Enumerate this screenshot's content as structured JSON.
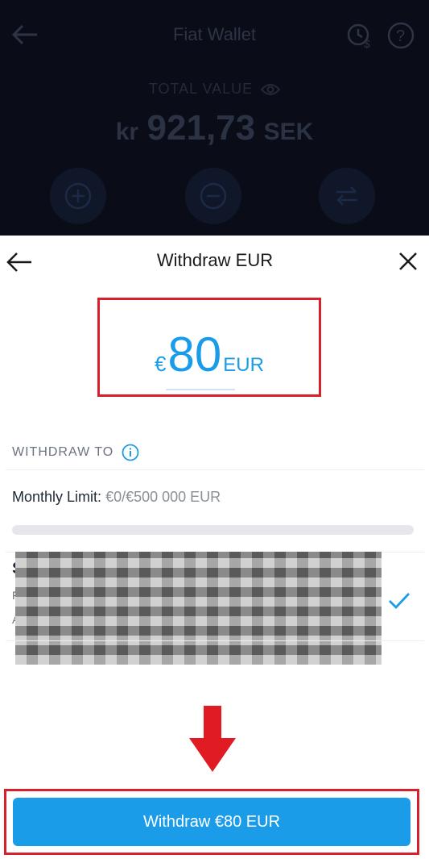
{
  "background_screen": {
    "title": "Fiat Wallet",
    "total_label": "TOTAL VALUE",
    "total_currency_prefix": "kr",
    "total_amount": "921,73",
    "total_currency_code": "SEK",
    "icons": {
      "back": "back-arrow-icon",
      "history": "clock-dollar-icon",
      "help": "question-icon",
      "visibility": "eye-icon",
      "add": "plus-circle-icon",
      "remove": "minus-circle-icon",
      "transfer": "transfer-arrows-icon"
    }
  },
  "sheet": {
    "title": "Withdraw EUR",
    "amount_symbol": "€",
    "amount_value": "80",
    "amount_code": "EUR",
    "withdraw_to_label": "WITHDRAW TO",
    "monthly_limit_label": "Monthly Limit:",
    "monthly_limit_value": "€0/€500 000 EUR",
    "monthly_limit_used_fraction": 0,
    "account_fragments": [
      "S",
      "F",
      "A"
    ],
    "withdraw_button_label": "Withdraw €80 EUR"
  },
  "colors": {
    "accent": "#1b9ce8",
    "highlight_red": "#d9202a",
    "backdrop": "#0a0d18"
  }
}
